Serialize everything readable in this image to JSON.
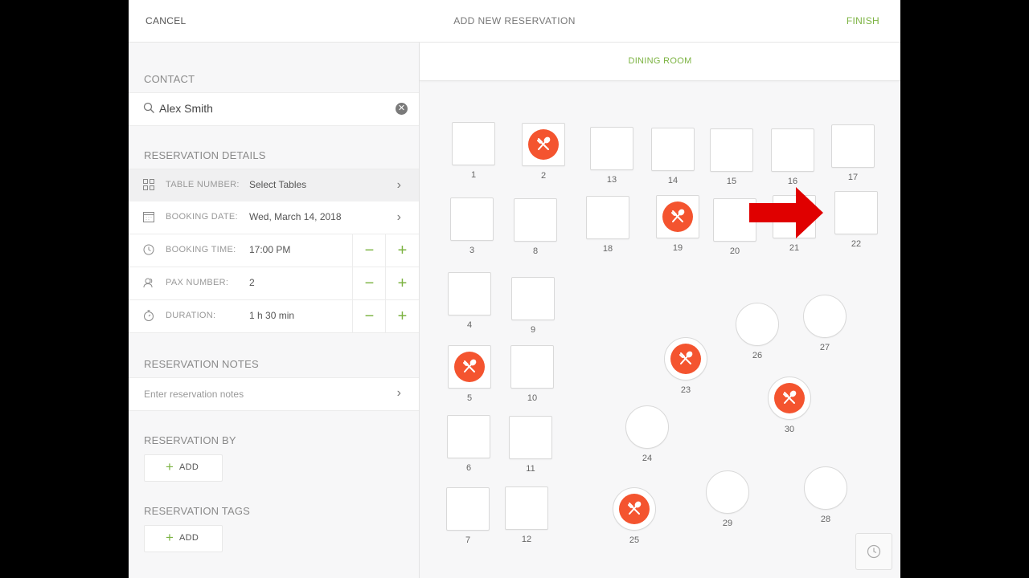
{
  "header": {
    "cancel": "CANCEL",
    "title": "ADD NEW RESERVATION",
    "finish": "FINISH"
  },
  "contact": {
    "section": "CONTACT",
    "value": "Alex Smith"
  },
  "details": {
    "section": "RESERVATION DETAILS",
    "rows": [
      {
        "label": "TABLE NUMBER:",
        "value": "Select Tables"
      },
      {
        "label": "BOOKING DATE:",
        "value": "Wed, March 14, 2018"
      },
      {
        "label": "BOOKING TIME:",
        "value": "17:00 PM"
      },
      {
        "label": "PAX NUMBER:",
        "value": "2"
      },
      {
        "label": "DURATION:",
        "value": "1 h 30 min"
      }
    ]
  },
  "notes": {
    "section": "RESERVATION NOTES",
    "placeholder": "Enter reservation notes"
  },
  "by": {
    "section": "RESERVATION BY",
    "add": "ADD"
  },
  "tags": {
    "section": "RESERVATION TAGS",
    "add": "ADD"
  },
  "floor": {
    "tab": "DINING ROOM",
    "tables": [
      {
        "number": "1",
        "shape": "square",
        "occupied": false
      },
      {
        "number": "2",
        "shape": "square",
        "occupied": true
      },
      {
        "number": "13",
        "shape": "square",
        "occupied": false
      },
      {
        "number": "14",
        "shape": "square",
        "occupied": false
      },
      {
        "number": "15",
        "shape": "square",
        "occupied": false
      },
      {
        "number": "16",
        "shape": "square",
        "occupied": false
      },
      {
        "number": "17",
        "shape": "square",
        "occupied": false
      },
      {
        "number": "3",
        "shape": "square",
        "occupied": false
      },
      {
        "number": "8",
        "shape": "square",
        "occupied": false
      },
      {
        "number": "18",
        "shape": "square",
        "occupied": false
      },
      {
        "number": "19",
        "shape": "square",
        "occupied": true
      },
      {
        "number": "20",
        "shape": "square",
        "occupied": false
      },
      {
        "number": "21",
        "shape": "square",
        "occupied": false
      },
      {
        "number": "22",
        "shape": "square",
        "occupied": false
      },
      {
        "number": "4",
        "shape": "square",
        "occupied": false
      },
      {
        "number": "9",
        "shape": "square",
        "occupied": false
      },
      {
        "number": "5",
        "shape": "square",
        "occupied": true
      },
      {
        "number": "10",
        "shape": "square",
        "occupied": false
      },
      {
        "number": "6",
        "shape": "square",
        "occupied": false
      },
      {
        "number": "11",
        "shape": "square",
        "occupied": false
      },
      {
        "number": "7",
        "shape": "square",
        "occupied": false
      },
      {
        "number": "12",
        "shape": "square",
        "occupied": false
      },
      {
        "number": "26",
        "shape": "round",
        "occupied": false
      },
      {
        "number": "27",
        "shape": "round",
        "occupied": false
      },
      {
        "number": "23",
        "shape": "round",
        "occupied": true
      },
      {
        "number": "30",
        "shape": "round",
        "occupied": true
      },
      {
        "number": "24",
        "shape": "round",
        "occupied": false
      },
      {
        "number": "25",
        "shape": "round",
        "occupied": true
      },
      {
        "number": "29",
        "shape": "round",
        "occupied": false
      },
      {
        "number": "28",
        "shape": "round",
        "occupied": false
      }
    ]
  },
  "colors": {
    "accent": "#7cb342",
    "occupied": "#f4542f",
    "arrow": "#e00000"
  },
  "icons": {
    "search": "search-icon",
    "clear": "clear-icon",
    "grid": "grid-icon",
    "calendar": "calendar-icon",
    "clock": "clock-icon",
    "person": "person-icon",
    "timer": "timer-icon",
    "chevron": "chevron-right-icon",
    "occupied": "fork-spoon-icon",
    "arrow": "red-arrow-icon"
  }
}
